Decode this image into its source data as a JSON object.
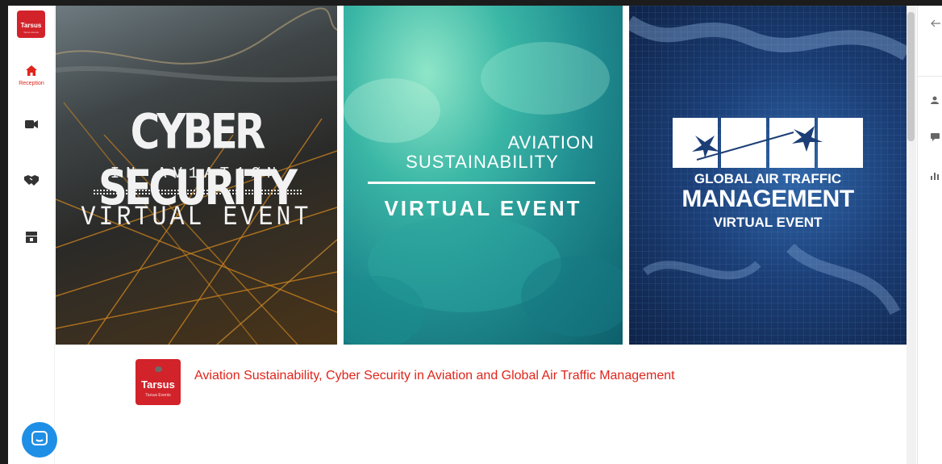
{
  "leftnav": {
    "logo": {
      "text": "Tarsus",
      "subtext": "Tarsus Events"
    },
    "items": [
      {
        "id": "reception",
        "icon": "home-icon",
        "label": "Reception",
        "active": true
      },
      {
        "id": "video",
        "icon": "video-camera-icon",
        "label": ""
      },
      {
        "id": "networking",
        "icon": "handshake-icon",
        "label": ""
      },
      {
        "id": "exhibition",
        "icon": "booth-icon",
        "label": ""
      }
    ]
  },
  "banner": {
    "panels": [
      {
        "id": "cyber",
        "line1": "CYBER SECURITY",
        "line2": "IN AV1AT1ØN",
        "line3": "VIRTUAL EVENT"
      },
      {
        "id": "sustainability",
        "line1": "AVIATION",
        "line2": "SUSTAINABILITY",
        "line3": "VIRTUAL EVENT"
      },
      {
        "id": "atm",
        "line1": "GLOBAL AIR TRAFFIC",
        "line2": "MANAGEMENT",
        "line3": "VIRTUAL EVENT"
      }
    ]
  },
  "info": {
    "logo": {
      "text": "Tarsus",
      "subtext": "Tarsus Events"
    },
    "title": "Aviation Sustainability, Cyber Security in Aviation and Global Air Traffic Management"
  },
  "rightpanel": {
    "icons": [
      "back-arrow-icon",
      "user-icon",
      "chat-icon",
      "bar-chart-icon"
    ]
  },
  "colors": {
    "accent": "#e0251b",
    "brand": "#d2232a",
    "chat": "#1f8fe6"
  }
}
